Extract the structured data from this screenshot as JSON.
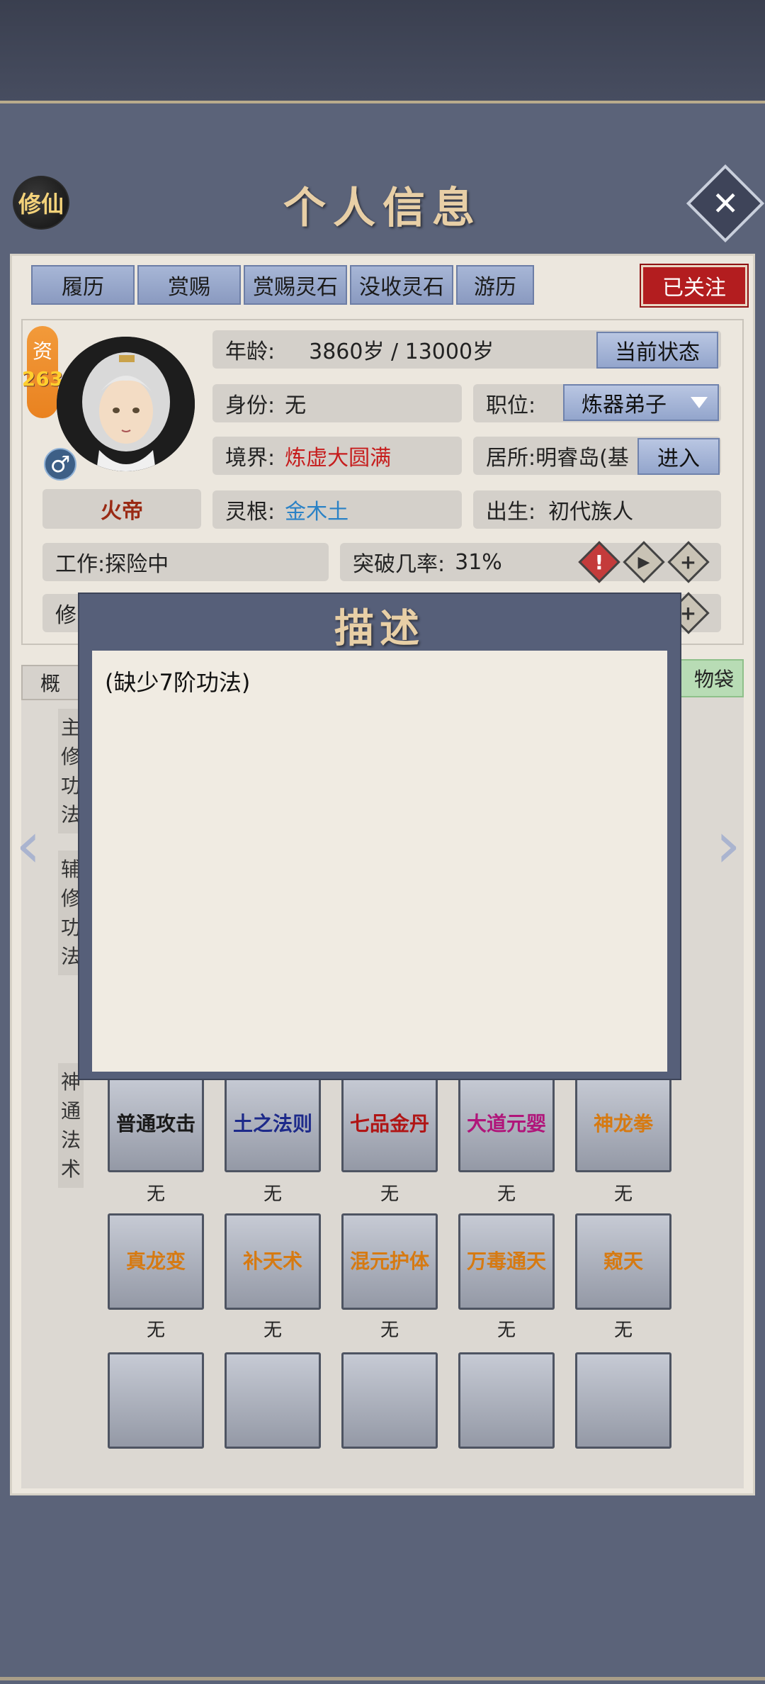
{
  "header": {
    "badge": "修仙",
    "title": "个人信息",
    "close_icon": "close-icon"
  },
  "tabs": [
    {
      "label": "履历"
    },
    {
      "label": "赏赐"
    },
    {
      "label": "赏赐灵石"
    },
    {
      "label": "没收灵石"
    },
    {
      "label": "游历"
    }
  ],
  "follow_button": "已关注",
  "profile": {
    "zi_label": "资",
    "zi_value": "263",
    "gender_symbol": "♂",
    "name": "火帝",
    "age_label": "年龄:",
    "age_value": "3860岁 / 13000岁",
    "status_button": "当前状态",
    "identity_label": "身份:",
    "identity_value": "无",
    "position_label": "职位:",
    "position_value": "炼器弟子",
    "realm_label": "境界:",
    "realm_value": "炼虚大圆满",
    "residence_label": "居所:",
    "residence_value": "明睿岛(基",
    "enter_button": "进入",
    "root_label": "灵根:",
    "root_value": "金木土",
    "birth_label": "出生:",
    "birth_value": "初代族人",
    "work_label": "工作:",
    "work_value": "探险中",
    "breakthrough_label": "突破几率:",
    "breakthrough_value": "31%",
    "partial_row_text": "修",
    "alert_icon": "!",
    "play_icon": "▶",
    "plus_icon": "+"
  },
  "lower_tabs": {
    "overview": "概",
    "bag": "物袋"
  },
  "sections": {
    "main_cultivation": [
      "主",
      "修",
      "功",
      "法"
    ],
    "aux_cultivation": [
      "辅",
      "修",
      "功",
      "法"
    ],
    "divine_arts": [
      "神",
      "通",
      "法",
      "术"
    ]
  },
  "skills_row1": [
    {
      "name": "普通攻击",
      "status": "无",
      "color": "#1a1a1a"
    },
    {
      "name": "土之法则",
      "status": "无",
      "color": "#1d2a8a"
    },
    {
      "name": "七品金丹",
      "status": "无",
      "color": "#b01515"
    },
    {
      "name": "大道元婴",
      "status": "无",
      "color": "#b0157a"
    },
    {
      "name": "神龙拳",
      "status": "无",
      "color": "#d67a12"
    }
  ],
  "skills_row2": [
    {
      "name": "真龙变",
      "status": "无",
      "color": "#d67a12"
    },
    {
      "name": "补天术",
      "status": "无",
      "color": "#d67a12"
    },
    {
      "name": "混元护体",
      "status": "无",
      "color": "#d67a12"
    },
    {
      "name": "万毒通天",
      "status": "无",
      "color": "#d67a12"
    },
    {
      "name": "窥天",
      "status": "无",
      "color": "#d67a12"
    }
  ],
  "modal": {
    "title": "描述",
    "body": "(缺少7阶功法)"
  }
}
